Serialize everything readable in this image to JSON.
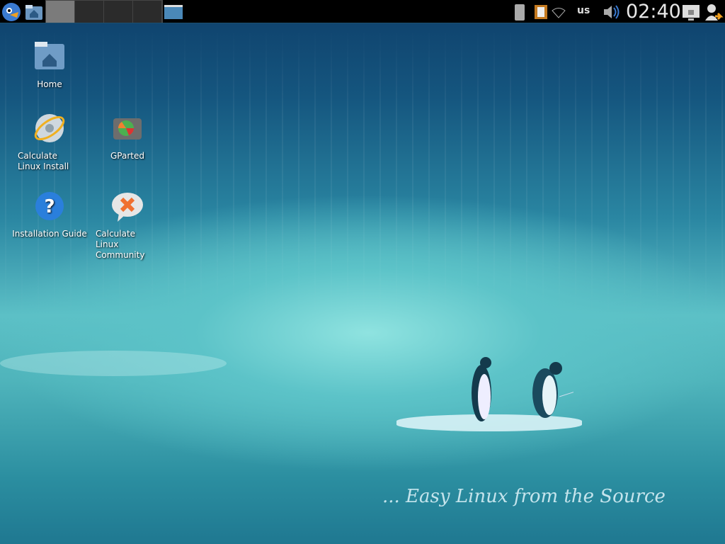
{
  "panel": {
    "pager_desktops": 4,
    "active_desktop": 1,
    "keyboard_layout": "us",
    "clock": "02:40"
  },
  "desktop": {
    "icons": [
      {
        "label": "Home"
      },
      {
        "label": "Calculate Linux Install"
      },
      {
        "label": "GParted"
      },
      {
        "label": "Installation Guide"
      },
      {
        "label": "Calculate Linux Community"
      }
    ]
  },
  "wallpaper": {
    "slogan": "... Easy Linux from the Source"
  },
  "colors": {
    "panel": "#000000",
    "accent": "#2a86a2"
  }
}
